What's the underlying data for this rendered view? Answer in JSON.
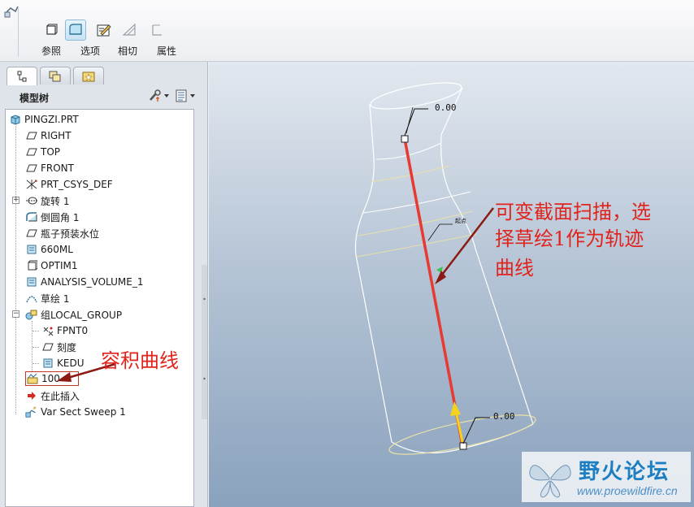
{
  "dashboard": {
    "tools": [
      {
        "label": "参照",
        "icon": "references-icon",
        "active": false
      },
      {
        "label": "选项",
        "icon": "options-icon",
        "active": true
      },
      {
        "label": "相切",
        "icon": "tangency-icon",
        "active": false
      },
      {
        "label": "属性",
        "icon": "properties-icon",
        "active": false
      }
    ]
  },
  "left_panel": {
    "tabs": [
      "model-tree-tab-icon",
      "layers-tab-icon",
      "favorites-tab-icon"
    ],
    "tree_title": "模型树",
    "tree_tools": [
      "settings-icon",
      "show-icon"
    ],
    "nodes": [
      {
        "label": "PINGZI.PRT",
        "icon": "part-icon"
      },
      {
        "label": "RIGHT",
        "icon": "datum-plane-icon"
      },
      {
        "label": "TOP",
        "icon": "datum-plane-icon"
      },
      {
        "label": "FRONT",
        "icon": "datum-plane-icon"
      },
      {
        "label": "PRT_CSYS_DEF",
        "icon": "csys-icon"
      },
      {
        "label": "旋转 1",
        "icon": "revolve-icon"
      },
      {
        "label": "倒圆角 1",
        "icon": "round-icon"
      },
      {
        "label": "瓶子预装水位",
        "icon": "datum-plane-icon"
      },
      {
        "label": "660ML",
        "icon": "analysis-icon"
      },
      {
        "label": "OPTIM1",
        "icon": "optim-icon"
      },
      {
        "label": "ANALYSIS_VOLUME_1",
        "icon": "analysis-icon"
      },
      {
        "label": "草绘 1",
        "icon": "sketch-icon"
      },
      {
        "label": "组LOCAL_GROUP",
        "icon": "group-icon"
      },
      {
        "label": "FPNT0",
        "icon": "datum-point-icon"
      },
      {
        "label": "刻度",
        "icon": "datum-plane-icon"
      },
      {
        "label": "KEDU",
        "icon": "analysis-icon"
      },
      {
        "label": "100",
        "icon": "graph-icon"
      },
      {
        "label": "在此插入",
        "icon": "insert-arrow-icon"
      },
      {
        "label": "Var Sect Sweep 1",
        "icon": "var-sect-sweep-icon"
      }
    ]
  },
  "viewport": {
    "dimensions": [
      "0.00",
      "0.00"
    ],
    "start_label": "起点",
    "annotation_sweep": [
      "可变截面扫描，选",
      "择草绘1作为轨迹",
      "曲线"
    ],
    "annotation_volume": "容积曲线"
  },
  "watermark": {
    "title": "野火论坛",
    "url": "www.proewildfire.cn"
  },
  "colors": {
    "trajectory": "#e63a32",
    "annotation": "#e0241d",
    "origin_arrow": "#f5d21c",
    "watermark_blue": "#1d7fc1"
  }
}
